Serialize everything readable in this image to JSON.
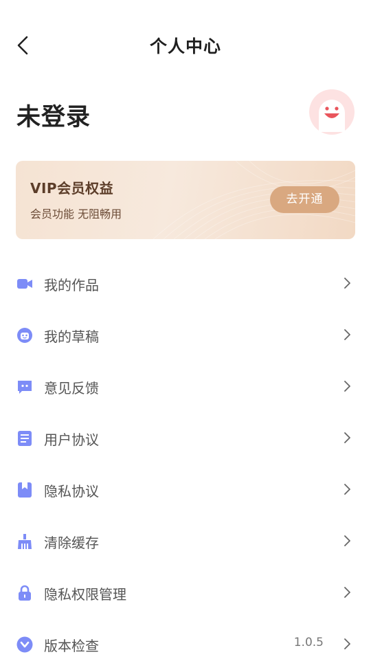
{
  "header": {
    "title": "个人中心",
    "back_icon": "chevron-left-icon"
  },
  "user": {
    "name": "未登录",
    "avatar_icon": "smiley-avatar-icon"
  },
  "vip": {
    "title": "VIP会员权益",
    "subtitle": "会员功能 无阻畅用",
    "button_label": "去开通"
  },
  "colors": {
    "accent": "#7d8cf7",
    "vip_button": "#d9a880",
    "vip_text": "#5c3d29"
  },
  "menu": [
    {
      "label": "我的作品",
      "icon": "video-camera-icon",
      "value": ""
    },
    {
      "label": "我的草稿",
      "icon": "robot-face-icon",
      "value": ""
    },
    {
      "label": "意见反馈",
      "icon": "chat-bubble-icon",
      "value": ""
    },
    {
      "label": "用户协议",
      "icon": "document-icon",
      "value": ""
    },
    {
      "label": "隐私协议",
      "icon": "bookmark-icon",
      "value": ""
    },
    {
      "label": "清除缓存",
      "icon": "broom-icon",
      "value": ""
    },
    {
      "label": "隐私权限管理",
      "icon": "lock-icon",
      "value": ""
    },
    {
      "label": "版本检查",
      "icon": "version-check-icon",
      "value": "1.0.5"
    }
  ]
}
